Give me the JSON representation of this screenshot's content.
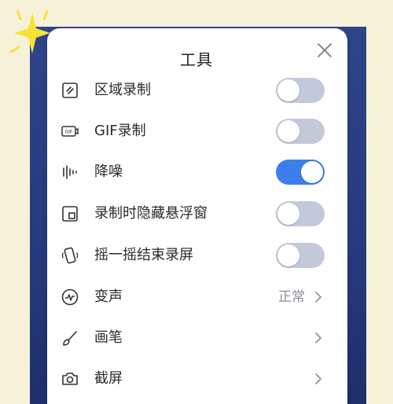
{
  "dialog": {
    "title": "工具"
  },
  "items": [
    {
      "label": "区域录制",
      "icon": "region-record-icon",
      "control": "toggle",
      "state": "off"
    },
    {
      "label": "GIF录制",
      "icon": "gif-icon",
      "control": "toggle",
      "state": "off"
    },
    {
      "label": "降噪",
      "icon": "waveform-icon",
      "control": "toggle",
      "state": "on"
    },
    {
      "label": "录制时隐藏悬浮窗",
      "icon": "floating-window-icon",
      "control": "toggle",
      "state": "off"
    },
    {
      "label": "摇一摇结束录屏",
      "icon": "shake-phone-icon",
      "control": "toggle",
      "state": "off"
    },
    {
      "label": "变声",
      "icon": "voice-change-icon",
      "control": "link",
      "value": "正常"
    },
    {
      "label": "画笔",
      "icon": "brush-icon",
      "control": "link",
      "value": ""
    },
    {
      "label": "截屏",
      "icon": "camera-icon",
      "control": "link",
      "value": ""
    }
  ],
  "colors": {
    "toggle_on": "#3d7fea",
    "toggle_off": "#c3c9d9",
    "background": "#2f458a",
    "page": "#f6f2d9"
  }
}
